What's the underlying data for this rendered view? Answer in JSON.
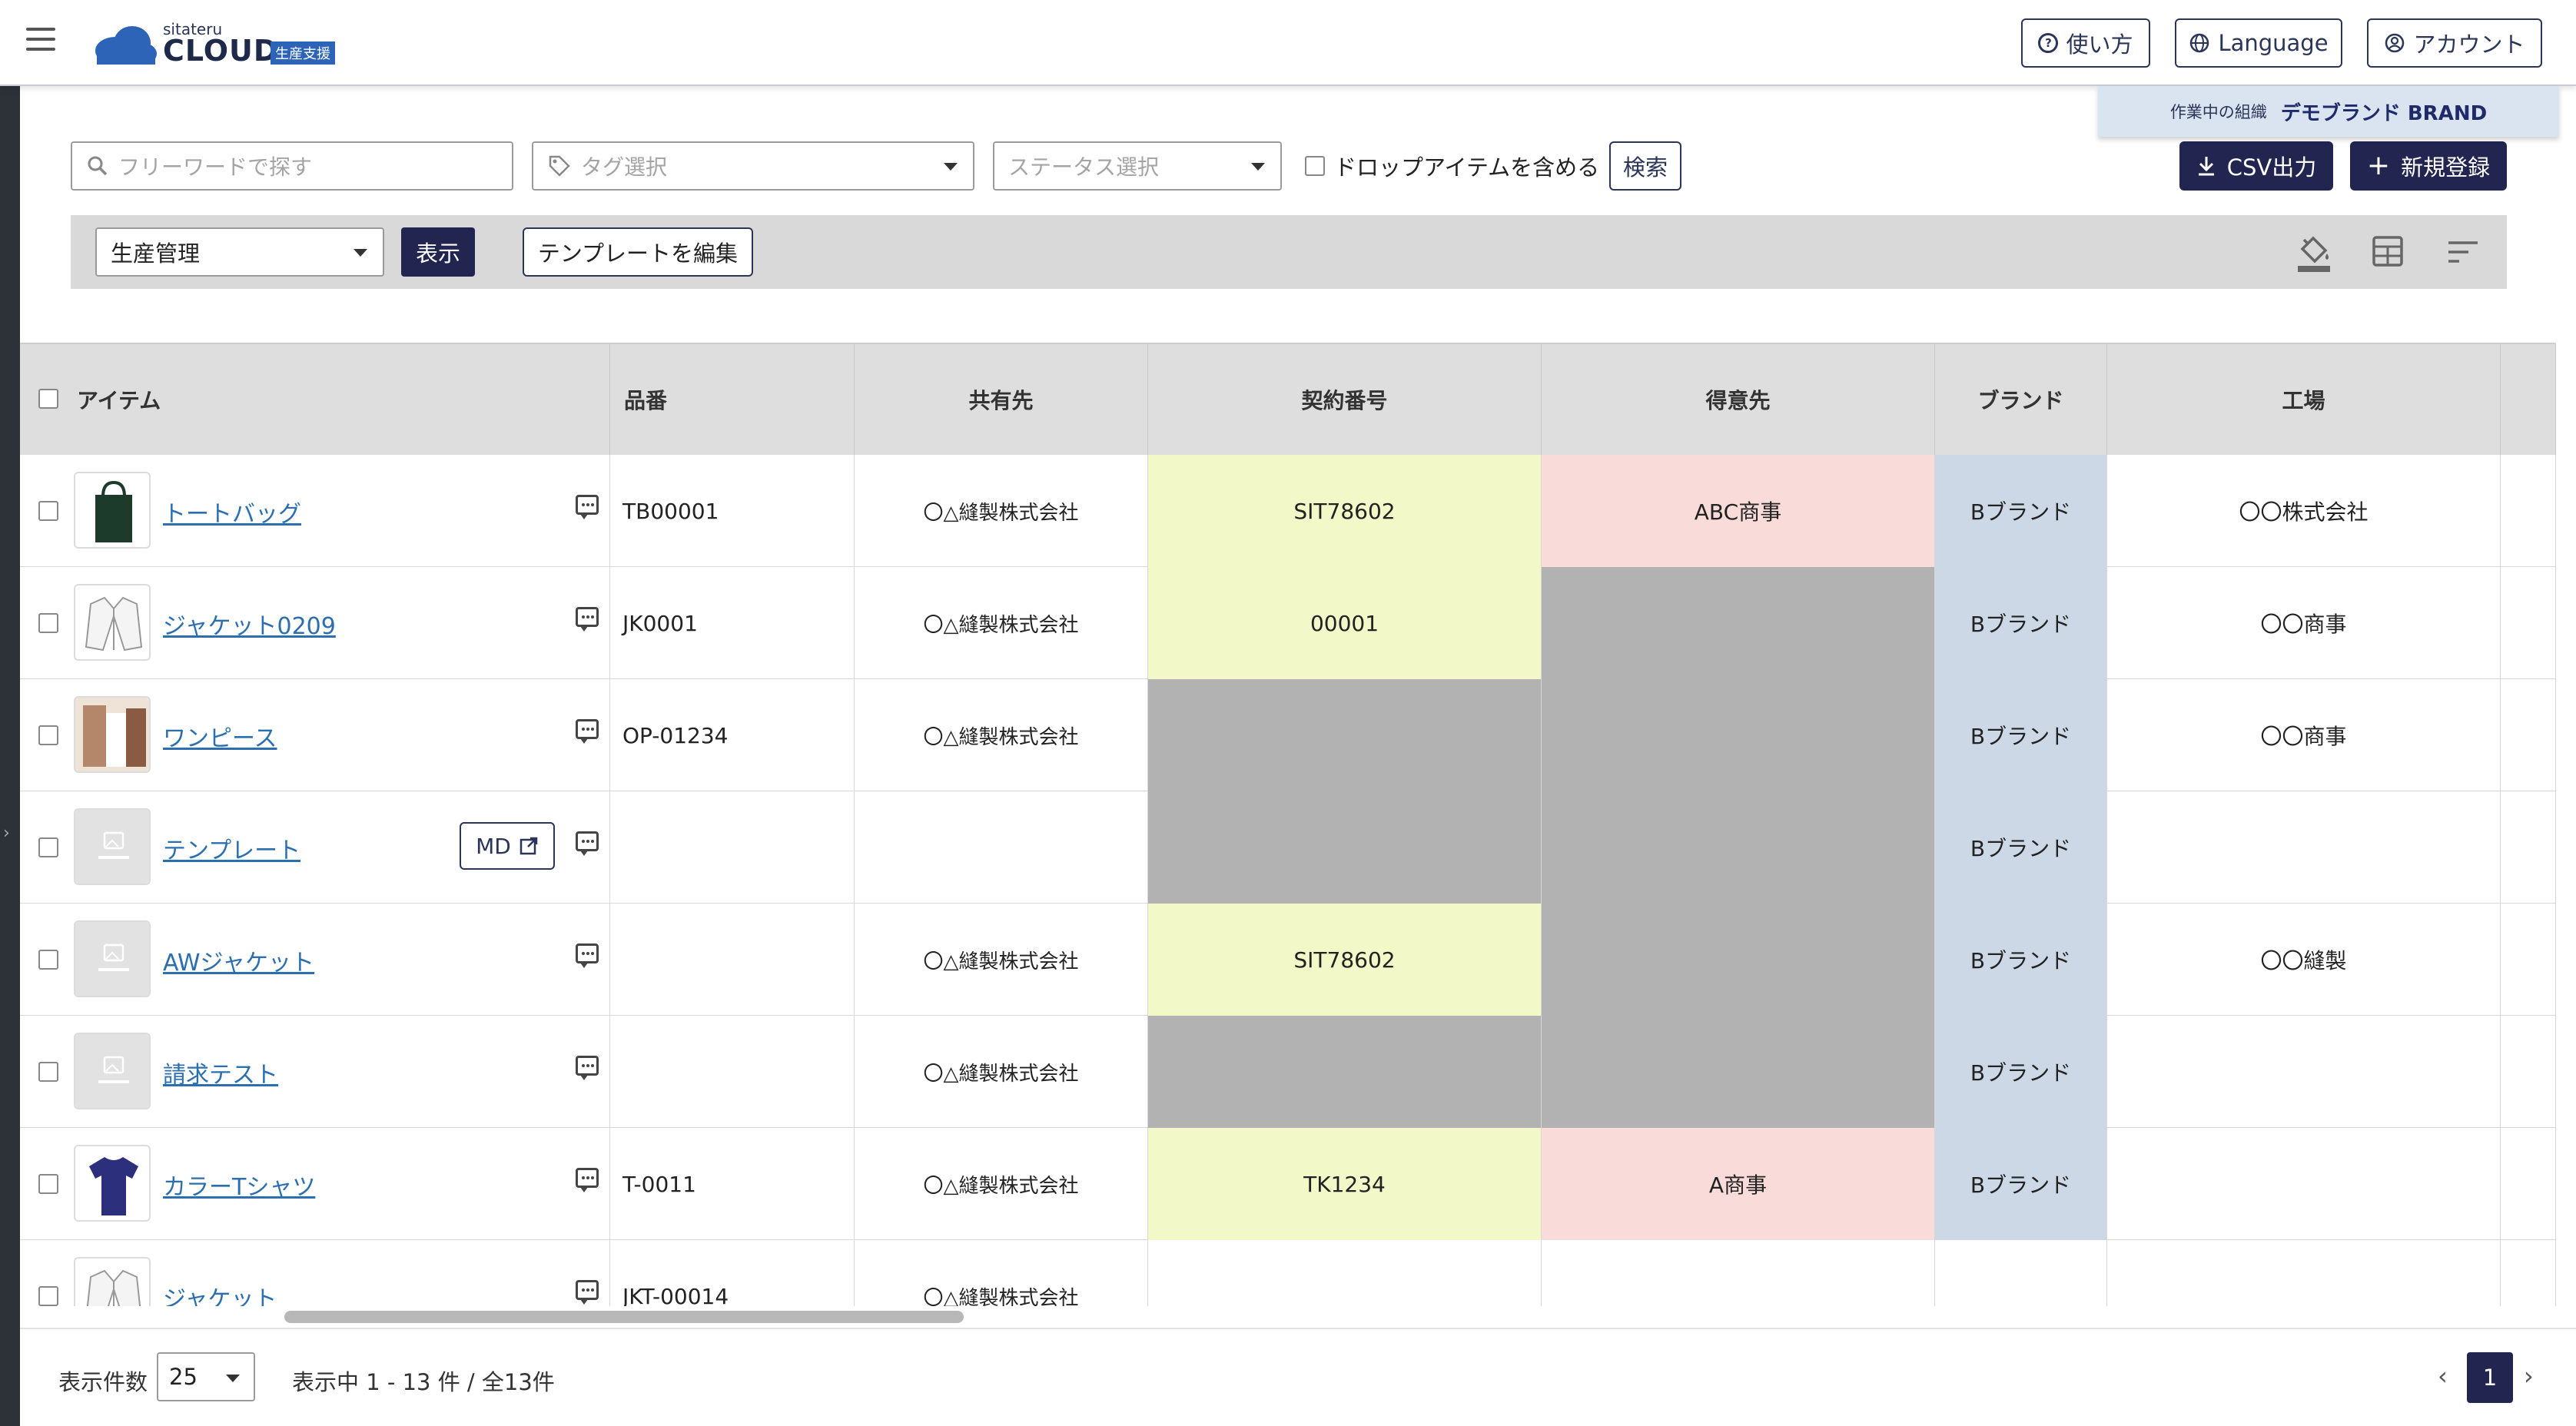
{
  "header": {
    "logo_small": "sitateru",
    "logo_main": "CLOUD",
    "logo_badge": "生産支援",
    "help_label": "使い方",
    "language_label": "Language",
    "account_label": "アカウント"
  },
  "org": {
    "label": "作業中の組織",
    "name": "デモブランド BRAND"
  },
  "search": {
    "keyword_placeholder": "フリーワードで探す",
    "tag_placeholder": "タグ選択",
    "status_placeholder": "ステータス選択",
    "drop_items_label": "ドロップアイテムを含める",
    "search_button": "検索",
    "csv_button": "CSV出力",
    "new_button": "新規登録"
  },
  "template_bar": {
    "selected_template": "生産管理",
    "show_button": "表示",
    "edit_template_button": "テンプレートを編集"
  },
  "table": {
    "columns": [
      "アイテム",
      "品番",
      "共有先",
      "契約番号",
      "得意先",
      "ブランド",
      "工場"
    ],
    "rows": [
      {
        "name": "トートバッグ",
        "code": "TB00001",
        "shared": "〇△縫製株式会社",
        "contract": "SIT78602",
        "customer": "ABC商事",
        "brand": "Bブランド",
        "factory": "〇〇株式会社"
      },
      {
        "name": "ジャケット0209",
        "code": "JK0001",
        "shared": "〇△縫製株式会社",
        "contract": "00001",
        "customer": "",
        "brand": "Bブランド",
        "factory": "〇〇商事"
      },
      {
        "name": "ワンピース",
        "code": "OP-01234",
        "shared": "〇△縫製株式会社",
        "contract": "",
        "customer": "",
        "brand": "Bブランド",
        "factory": "〇〇商事"
      },
      {
        "name": "テンプレート",
        "code": "",
        "shared": "",
        "contract": "",
        "customer": "",
        "brand": "Bブランド",
        "factory": "",
        "md_label": "MD"
      },
      {
        "name": "AWジャケット",
        "code": "",
        "shared": "〇△縫製株式会社",
        "contract": "SIT78602",
        "customer": "",
        "brand": "Bブランド",
        "factory": "〇〇縫製"
      },
      {
        "name": "請求テスト",
        "code": "",
        "shared": "〇△縫製株式会社",
        "contract": "",
        "customer": "",
        "brand": "Bブランド",
        "factory": ""
      },
      {
        "name": "カラーTシャツ",
        "code": "T-0011",
        "shared": "〇△縫製株式会社",
        "contract": "TK1234",
        "customer": "A商事",
        "brand": "Bブランド",
        "factory": ""
      },
      {
        "name": "ジャケット",
        "code": "JKT-00014",
        "shared": "〇△縫製株式会社",
        "contract": "",
        "customer": "",
        "brand": "",
        "factory": ""
      }
    ]
  },
  "footer": {
    "per_page_label": "表示件数",
    "per_page_value": "25",
    "range_text": "表示中 1 - 13 件 / 全13件",
    "current_page": "1"
  },
  "colors": {
    "navy": "#21254f",
    "contract_fill": "#f2f8c8",
    "customer_fill": "#f9dcda",
    "brand_fill": "#cdd8e6",
    "empty_fill": "#b2b2b2",
    "link": "#2c6fb0"
  }
}
